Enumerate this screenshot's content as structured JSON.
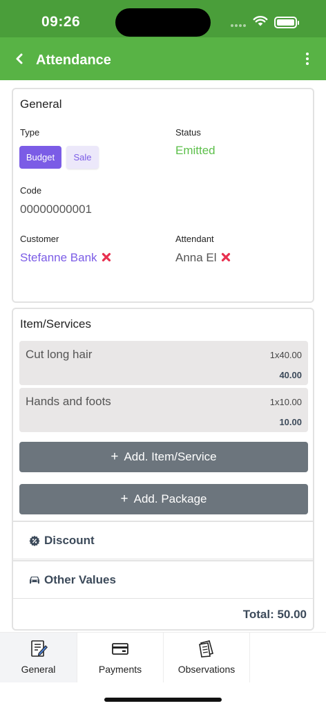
{
  "status_bar": {
    "time": "09:26"
  },
  "header": {
    "title": "Attendance"
  },
  "general": {
    "title": "General",
    "type_label": "Type",
    "type_options": [
      "Budget",
      "Sale"
    ],
    "type_selected": "Budget",
    "status_label": "Status",
    "status_value": "Emitted",
    "code_label": "Code",
    "code_value": "00000000001",
    "customer_label": "Customer",
    "customer_value": "Stefanne Bank",
    "attendant_label": "Attendant",
    "attendant_value": "Anna El"
  },
  "items": {
    "title": "Item/Services",
    "rows": [
      {
        "name": "Cut long hair",
        "qty_price": "1x40.00",
        "total": "40.00"
      },
      {
        "name": "Hands and foots",
        "qty_price": "1x10.00",
        "total": "10.00"
      }
    ],
    "add_item_label": "Add. Item/Service",
    "add_package_label": "Add. Package",
    "discount_label": "Discount",
    "other_values_label": "Other Values",
    "total_label": "Total: 50.00"
  },
  "tabs": [
    {
      "label": "General",
      "active": true
    },
    {
      "label": "Payments",
      "active": false
    },
    {
      "label": "Observations",
      "active": false
    }
  ],
  "colors": {
    "header": "#58b345",
    "status_bar": "#4a9e3a",
    "accent": "#7b5ce6",
    "status_green": "#5cbf4a",
    "remove_red": "#e8304f",
    "button_gray": "#6c757d"
  },
  "icons": [
    "back-arrow-icon",
    "more-vertical-icon",
    "remove-icon",
    "discount-gear-icon",
    "car-icon",
    "document-edit-icon",
    "credit-card-icon",
    "notes-icon"
  ]
}
